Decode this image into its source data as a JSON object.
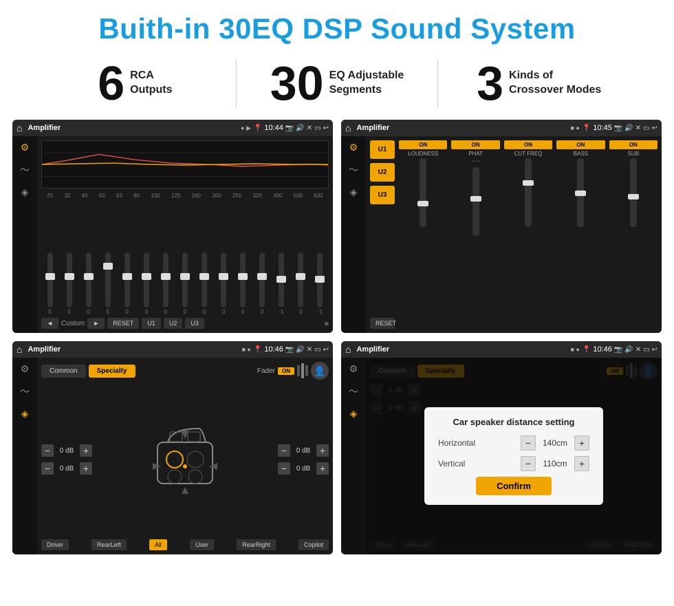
{
  "header": {
    "title": "Buith-in 30EQ DSP Sound System"
  },
  "stats": [
    {
      "number": "6",
      "label": "RCA\nOutputs"
    },
    {
      "number": "30",
      "label": "EQ Adjustable\nSegments"
    },
    {
      "number": "3",
      "label": "Kinds of\nCrossover Modes"
    }
  ],
  "screen1": {
    "app": "Amplifier",
    "time": "10:44",
    "eq_freqs": [
      "25",
      "32",
      "40",
      "50",
      "63",
      "80",
      "100",
      "125",
      "160",
      "200",
      "250",
      "320",
      "400",
      "500",
      "630"
    ],
    "eq_vals": [
      "0",
      "0",
      "0",
      "5",
      "0",
      "0",
      "0",
      "0",
      "0",
      "0",
      "0",
      "0",
      "-1",
      "0",
      "-1"
    ],
    "controls": [
      "◄",
      "Custom",
      "►",
      "RESET",
      "U1",
      "U2",
      "U3"
    ]
  },
  "screen2": {
    "app": "Amplifier",
    "time": "10:45",
    "u_buttons": [
      "U1",
      "U2",
      "U3"
    ],
    "channels": [
      "LOUDNESS",
      "PHAT",
      "CUT FREQ",
      "BASS",
      "SUB"
    ],
    "on_labels": [
      "ON",
      "ON",
      "ON",
      "ON",
      "ON"
    ],
    "reset_label": "RESET"
  },
  "screen3": {
    "app": "Amplifier",
    "time": "10:46",
    "tabs": [
      "Common",
      "Specialty"
    ],
    "fader_label": "Fader",
    "on_label": "ON",
    "db_values": [
      "0 dB",
      "0 dB",
      "0 dB",
      "0 dB"
    ],
    "speaker_buttons": [
      "Driver",
      "RearLeft",
      "All",
      "User",
      "RearRight",
      "Copilot"
    ]
  },
  "screen4": {
    "app": "Amplifier",
    "time": "10:46",
    "tabs": [
      "Common",
      "Specialty"
    ],
    "on_label": "ON",
    "dialog": {
      "title": "Car speaker distance setting",
      "horizontal_label": "Horizontal",
      "horizontal_value": "140cm",
      "vertical_label": "Vertical",
      "vertical_value": "110cm",
      "confirm_label": "Confirm"
    },
    "db_values": [
      "0 dB",
      "0 dB"
    ],
    "speaker_buttons": [
      "Driver",
      "RearLeft",
      "Copilot",
      "RearRight"
    ]
  },
  "colors": {
    "accent": "#f0a500",
    "blue": "#1a9de0",
    "dark_bg": "#1a1a1a"
  }
}
